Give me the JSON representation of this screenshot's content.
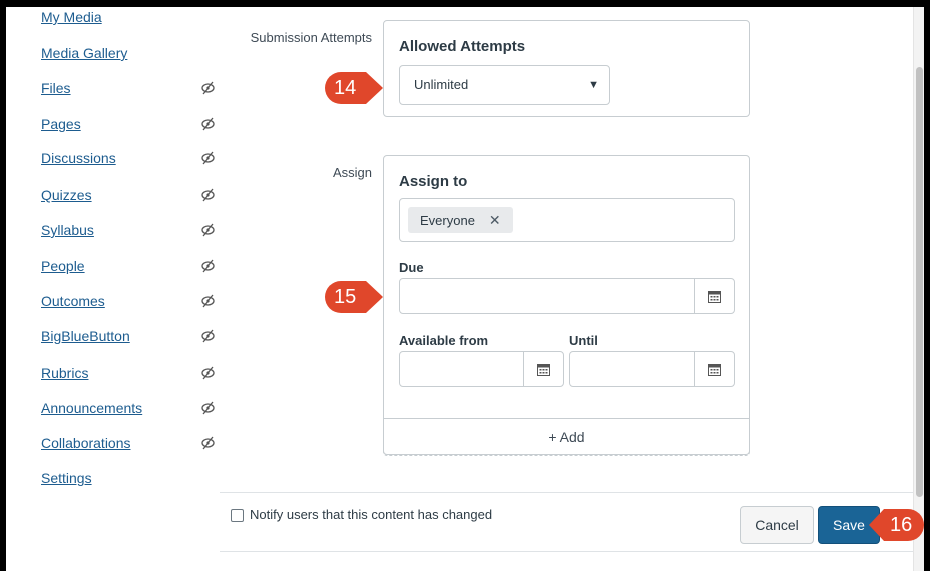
{
  "nav": {
    "items": [
      {
        "label": "My Media",
        "hidden": false
      },
      {
        "label": "Media Gallery",
        "hidden": false
      },
      {
        "label": "Files",
        "hidden": true
      },
      {
        "label": "Pages",
        "hidden": true
      },
      {
        "label": "Discussions",
        "hidden": true
      },
      {
        "label": "Quizzes",
        "hidden": true
      },
      {
        "label": "Syllabus",
        "hidden": true
      },
      {
        "label": "People",
        "hidden": true
      },
      {
        "label": "Outcomes",
        "hidden": true
      },
      {
        "label": "BigBlueButton",
        "hidden": true
      },
      {
        "label": "Rubrics",
        "hidden": true
      },
      {
        "label": "Announcements",
        "hidden": true
      },
      {
        "label": "Collaborations",
        "hidden": true
      },
      {
        "label": "Settings",
        "hidden": false
      }
    ],
    "hidden_icon": "eye-slash-icon"
  },
  "submission": {
    "row_label": "Submission Attempts",
    "title": "Allowed Attempts",
    "selected": "Unlimited"
  },
  "assign": {
    "row_label": "Assign",
    "title": "Assign to",
    "chip": "Everyone",
    "due_label": "Due",
    "due_value": "",
    "available_from_label": "Available from",
    "until_label": "Until",
    "add_label": "+ Add"
  },
  "footer": {
    "notify_label": "Notify users that this content has changed",
    "notify_checked": false,
    "cancel_label": "Cancel",
    "save_label": "Save"
  },
  "callouts": [
    "14",
    "15",
    "16"
  ],
  "colors": {
    "link": "#1d5c8f",
    "save_button": "#1a6496",
    "callout": "#e0472b"
  }
}
